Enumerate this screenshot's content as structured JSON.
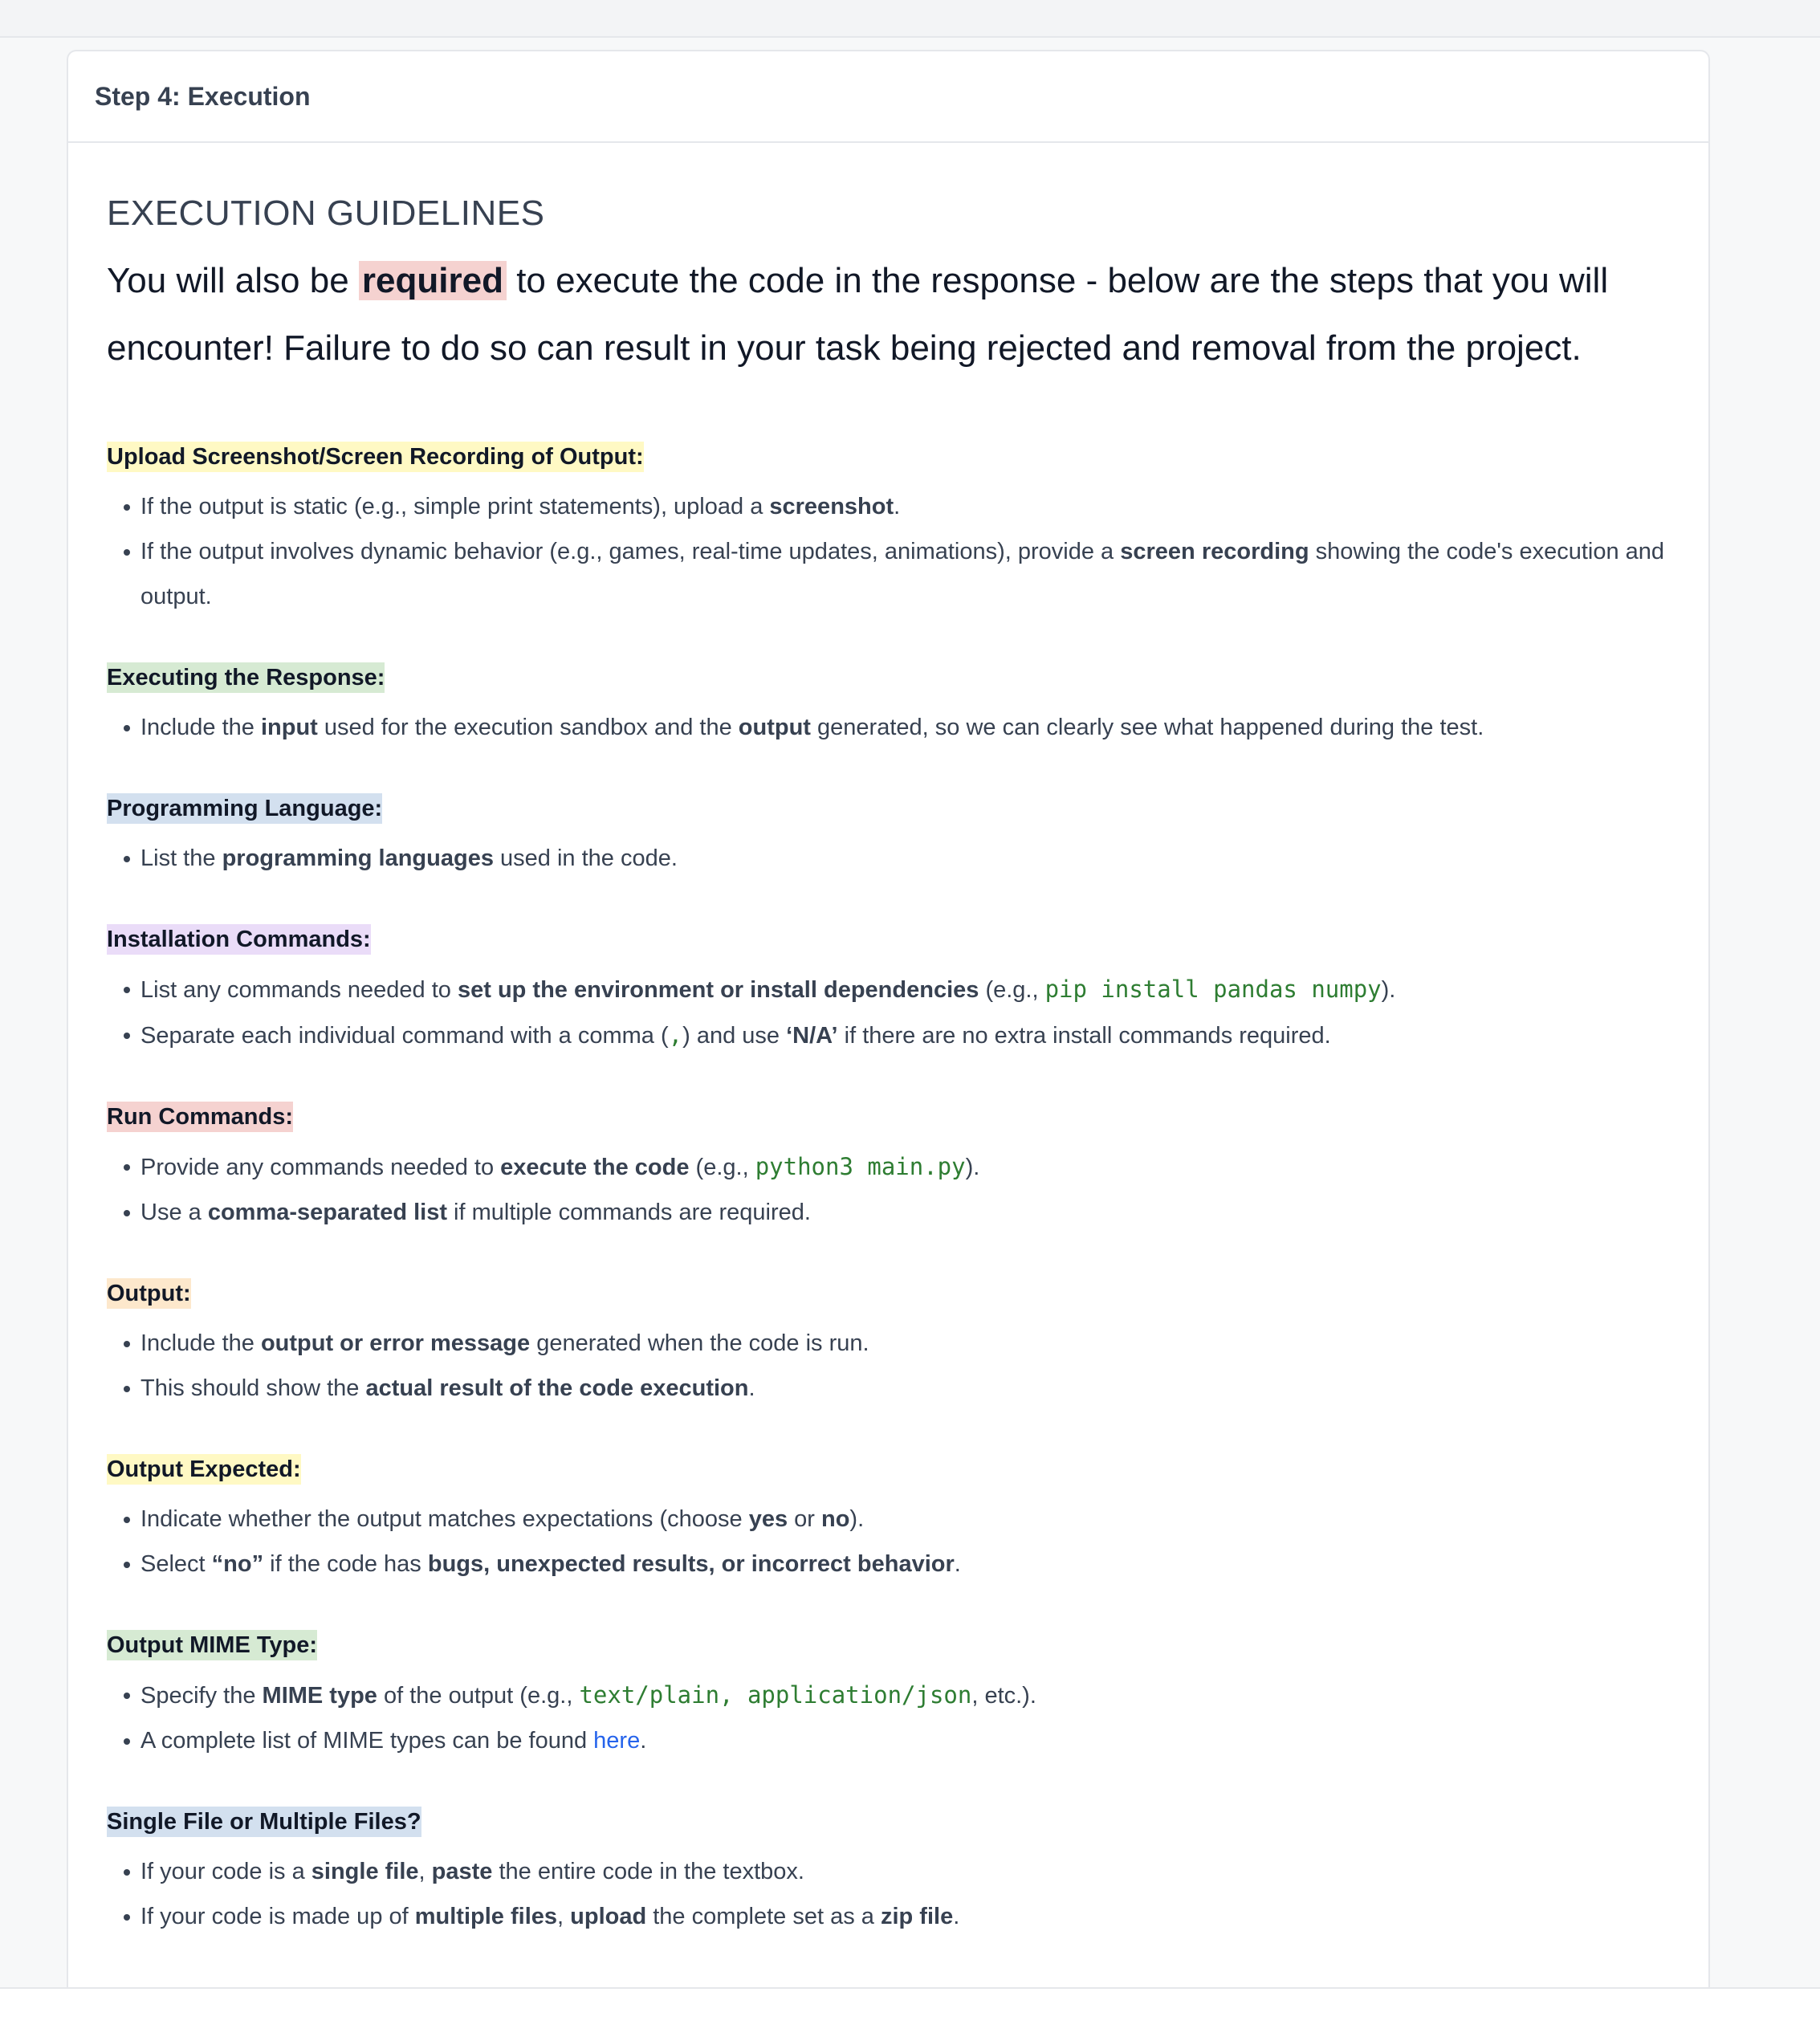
{
  "card": {
    "title": "Step 4: Execution"
  },
  "guidelines": {
    "heading": "EXECUTION GUIDELINES",
    "intro_pre": "You will also be ",
    "intro_req": "required",
    "intro_post": " to execute the code in the response - below are the steps that you will encounter! Failure to do so can result in your task being rejected and removal from the project."
  },
  "sections": {
    "upload": {
      "title": "Upload Screenshot/Screen Recording of Output:",
      "b1": {
        "t1": "If the output is static (e.g., simple print statements), upload a ",
        "b1": "screenshot",
        "t2": "."
      },
      "b2": {
        "t1": "If the output involves dynamic behavior (e.g., games, real-time updates, animations), provide a ",
        "b1": "screen recording",
        "t2": " showing the code's execution and output."
      }
    },
    "executing": {
      "title": "Executing the Response:",
      "b1": {
        "t1": "Include the ",
        "b1": "input",
        "t2": " used for the execution sandbox and the ",
        "b2": "output",
        "t3": " generated, so we can clearly see what happened during the test."
      }
    },
    "language": {
      "title": "Programming Language:",
      "b1": {
        "t1": "List the ",
        "b1": "programming languages",
        "t2": " used in the code."
      }
    },
    "install": {
      "title": "Installation Commands:",
      "b1": {
        "t1": "List any commands needed to ",
        "b1": "set up the environment or install dependencies",
        "t2": " (e.g., ",
        "c1": "pip install pandas numpy",
        "t3": ")."
      },
      "b2": {
        "t1": "Separate each individual command with a comma (",
        "c1": ",",
        "t2": ") and use ",
        "b1": "‘N/A’",
        "t3": " if there are no extra install commands required."
      }
    },
    "run": {
      "title": "Run Commands:",
      "b1": {
        "t1": "Provide any commands needed to ",
        "b1": "execute the code",
        "t2": " (e.g., ",
        "c1": "python3 main.py",
        "t3": ")."
      },
      "b2": {
        "t1": "Use a ",
        "b1": "comma-separated list",
        "t2": " if multiple commands are required."
      }
    },
    "output": {
      "title": "Output:",
      "b1": {
        "t1": "Include the ",
        "b1": "output or error message",
        "t2": " generated when the code is run."
      },
      "b2": {
        "t1": "This should show the ",
        "b1": "actual result of the code execution",
        "t2": "."
      }
    },
    "expected": {
      "title": "Output Expected:",
      "b1": {
        "t1": "Indicate whether the output matches expectations (choose ",
        "b1": "yes",
        "t2": " or ",
        "b2": "no",
        "t3": ")."
      },
      "b2": {
        "t1": "Select ",
        "b1": "“no”",
        "t2": " if the code has ",
        "b2": "bugs, unexpected results, or incorrect behavior",
        "t3": "."
      }
    },
    "mime": {
      "title": "Output MIME Type:",
      "b1": {
        "t1": "Specify the ",
        "b1": "MIME type",
        "t2": " of the output (e.g., ",
        "c1": "text/plain",
        "c2": ", ",
        "c3": "application/json",
        "t3": ", etc.)."
      },
      "b2": {
        "t1": "A complete list of MIME types can be found ",
        "link": "here",
        "t2": "."
      }
    },
    "files": {
      "title": "Single File or Multiple Files?",
      "b1": {
        "t1": "If your code is a ",
        "b1": "single file",
        "t2": ", ",
        "b2": "paste",
        "t3": " the entire code in the textbox."
      },
      "b2": {
        "t1": "If your code is made up of ",
        "b1": "multiple files",
        "t2": ", ",
        "b2": "upload",
        "t3": " the complete set as a ",
        "b3": "zip file",
        "t4": "."
      }
    }
  }
}
